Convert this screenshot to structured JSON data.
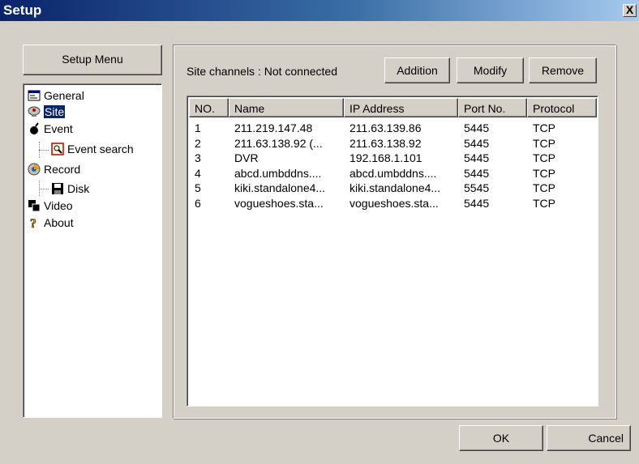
{
  "window": {
    "title": "Setup",
    "close_label": "X"
  },
  "setup_menu": {
    "label": "Setup Menu"
  },
  "tree": {
    "items": [
      {
        "label": "General",
        "icon": "general-icon"
      },
      {
        "label": "Site",
        "icon": "site-icon",
        "selected": true
      },
      {
        "label": "Event",
        "icon": "event-icon"
      },
      {
        "label": "Event search",
        "icon": "event-search-icon"
      },
      {
        "label": "Record",
        "icon": "record-icon"
      },
      {
        "label": "Disk",
        "icon": "disk-icon"
      },
      {
        "label": "Video",
        "icon": "video-icon"
      },
      {
        "label": "About",
        "icon": "about-icon"
      }
    ]
  },
  "site": {
    "status": "Site channels : Not connected",
    "buttons": {
      "addition": "Addition",
      "modify": "Modify",
      "remove": "Remove"
    },
    "columns": [
      "NO.",
      "Name",
      "IP Address",
      "Port No.",
      "Protocol"
    ],
    "rows": [
      [
        "1",
        "211.219.147.48",
        "211.63.139.86",
        "5445",
        "TCP"
      ],
      [
        "2",
        "211.63.138.92 (...",
        "211.63.138.92",
        "5445",
        "TCP"
      ],
      [
        "3",
        "DVR",
        "192.168.1.101",
        "5445",
        "TCP"
      ],
      [
        "4",
        "abcd.umbddns....",
        "abcd.umbddns....",
        "5445",
        "TCP"
      ],
      [
        "5",
        "kiki.standalone4...",
        "kiki.standalone4...",
        "5545",
        "TCP"
      ],
      [
        "6",
        "vogueshoes.sta...",
        "vogueshoes.sta...",
        "5445",
        "TCP"
      ]
    ]
  },
  "footer": {
    "ok": "OK",
    "cancel": "Cancel"
  },
  "colors": {
    "face": "#d4d0c8",
    "title_start": "#0a246a",
    "title_end": "#a6caf0",
    "selection": "#0a246a"
  }
}
